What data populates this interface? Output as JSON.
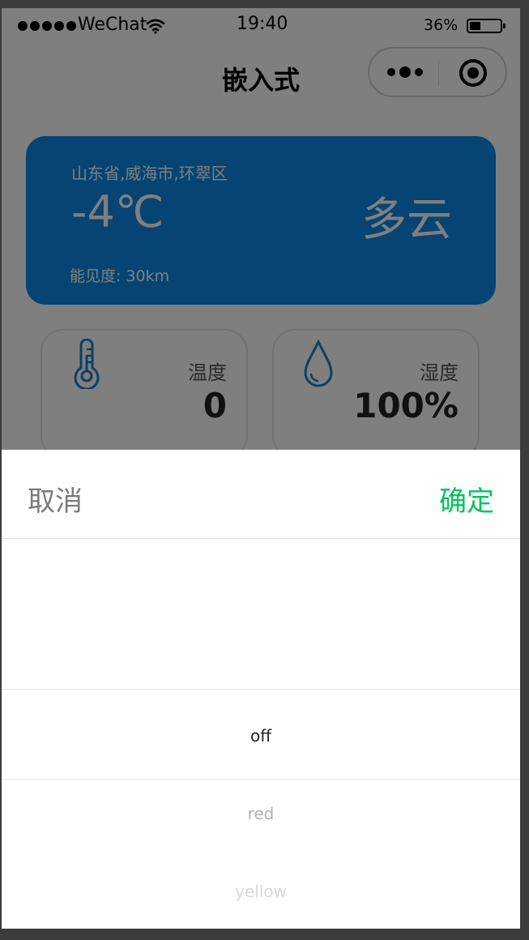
{
  "status_bar": {
    "carrier": "WeChat",
    "time": "19:40",
    "battery_percent": "36%",
    "battery_level": 0.36
  },
  "nav": {
    "title": "嵌入式"
  },
  "weather": {
    "location": "山东省,威海市,环翠区",
    "temperature": "-4℃",
    "condition": "多云",
    "visibility": "能见度: 30km"
  },
  "sensors": {
    "temperature_label": "温度",
    "temperature_value": "0",
    "humidity_label": "湿度",
    "humidity_value": "100%"
  },
  "picker": {
    "cancel_label": "取消",
    "confirm_label": "确定",
    "options": [
      "off",
      "red",
      "yellow"
    ],
    "selected": "off"
  },
  "colors": {
    "weather_card": "#0a89e6",
    "confirm_green": "#07c160",
    "sensor_icon_blue": "#1a7fc4"
  }
}
